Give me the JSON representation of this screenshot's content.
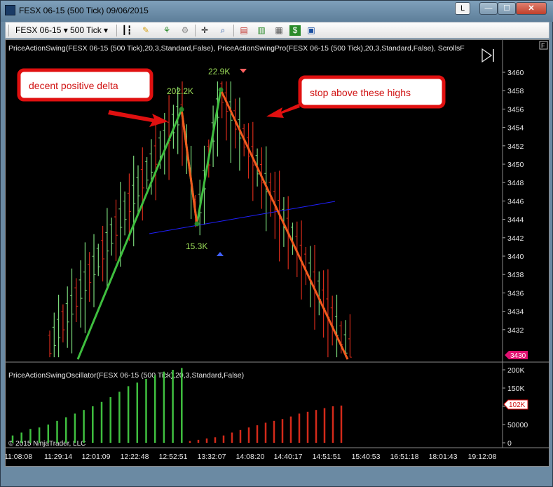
{
  "window": {
    "title": "FESX 06-15 (500 Tick)  09/06/2015",
    "btn_l": "L",
    "btn_min": "—",
    "btn_max": "☐",
    "btn_close": "✕"
  },
  "toolbar": {
    "instrument": "FESX 06-15",
    "interval": "500 Tick"
  },
  "chart": {
    "indicator_label": "PriceActionSwing(FESX 06-15 (500 Tick),20,3,Standard,False), PriceActionSwingPro(FESX 06-15 (500 Tick),20,3,Standard,False), ScrollsF",
    "oscillator_label": "PriceActionSwingOscillator(FESX 06-15 (500 Tick),20,3,Standard,False)",
    "copyright": "© 2015 NinjaTrader, LLC",
    "panel_button": "F",
    "price_ticks": [
      "3460",
      "3458",
      "3456",
      "3454",
      "3452",
      "3450",
      "3448",
      "3446",
      "3444",
      "3442",
      "3440",
      "3438",
      "3436",
      "3434",
      "3432"
    ],
    "current_price": "3430",
    "osc_ticks": [
      "200K",
      "150K",
      "100K",
      "50000",
      "0"
    ],
    "osc_current": "102K",
    "time_ticks": [
      "11:08:08",
      "11:29:14",
      "12:01:09",
      "12:22:48",
      "12:52:51",
      "13:32:07",
      "14:08:20",
      "14:40:17",
      "14:51:51",
      "15:40:53",
      "16:51:18",
      "18:01:43",
      "19:12:08"
    ],
    "swing_labels": {
      "high1": "202.2K",
      "high2": "22.9K",
      "low1": "15.3K"
    },
    "annotations": {
      "left": "decent positive delta",
      "right": "stop above these highs"
    },
    "colors": {
      "up": "#7ad87a",
      "down": "#d42a1a",
      "swing_up": "#3fbf3f",
      "swing_down": "#f05a1e",
      "trendline": "#2020ff",
      "callout_border": "#e01010",
      "callout_bg": "#e01010"
    }
  },
  "chart_data": {
    "type": "bar",
    "title": "",
    "series": [
      {
        "name": "oscillator_up",
        "values": [
          20000,
          28000,
          38000,
          42000,
          50000,
          60000,
          70000,
          80000,
          90000,
          100000,
          112000,
          125000,
          140000,
          155000,
          165000,
          175000,
          185000,
          195000,
          200000,
          205000
        ]
      },
      {
        "name": "oscillator_down",
        "values": [
          5000,
          8000,
          12000,
          15000,
          20000,
          28000,
          35000,
          42000,
          48000,
          55000,
          60000,
          65000,
          72000,
          80000,
          85000,
          90000,
          95000,
          100000,
          102000
        ]
      }
    ],
    "ylim": [
      0,
      210000
    ]
  }
}
